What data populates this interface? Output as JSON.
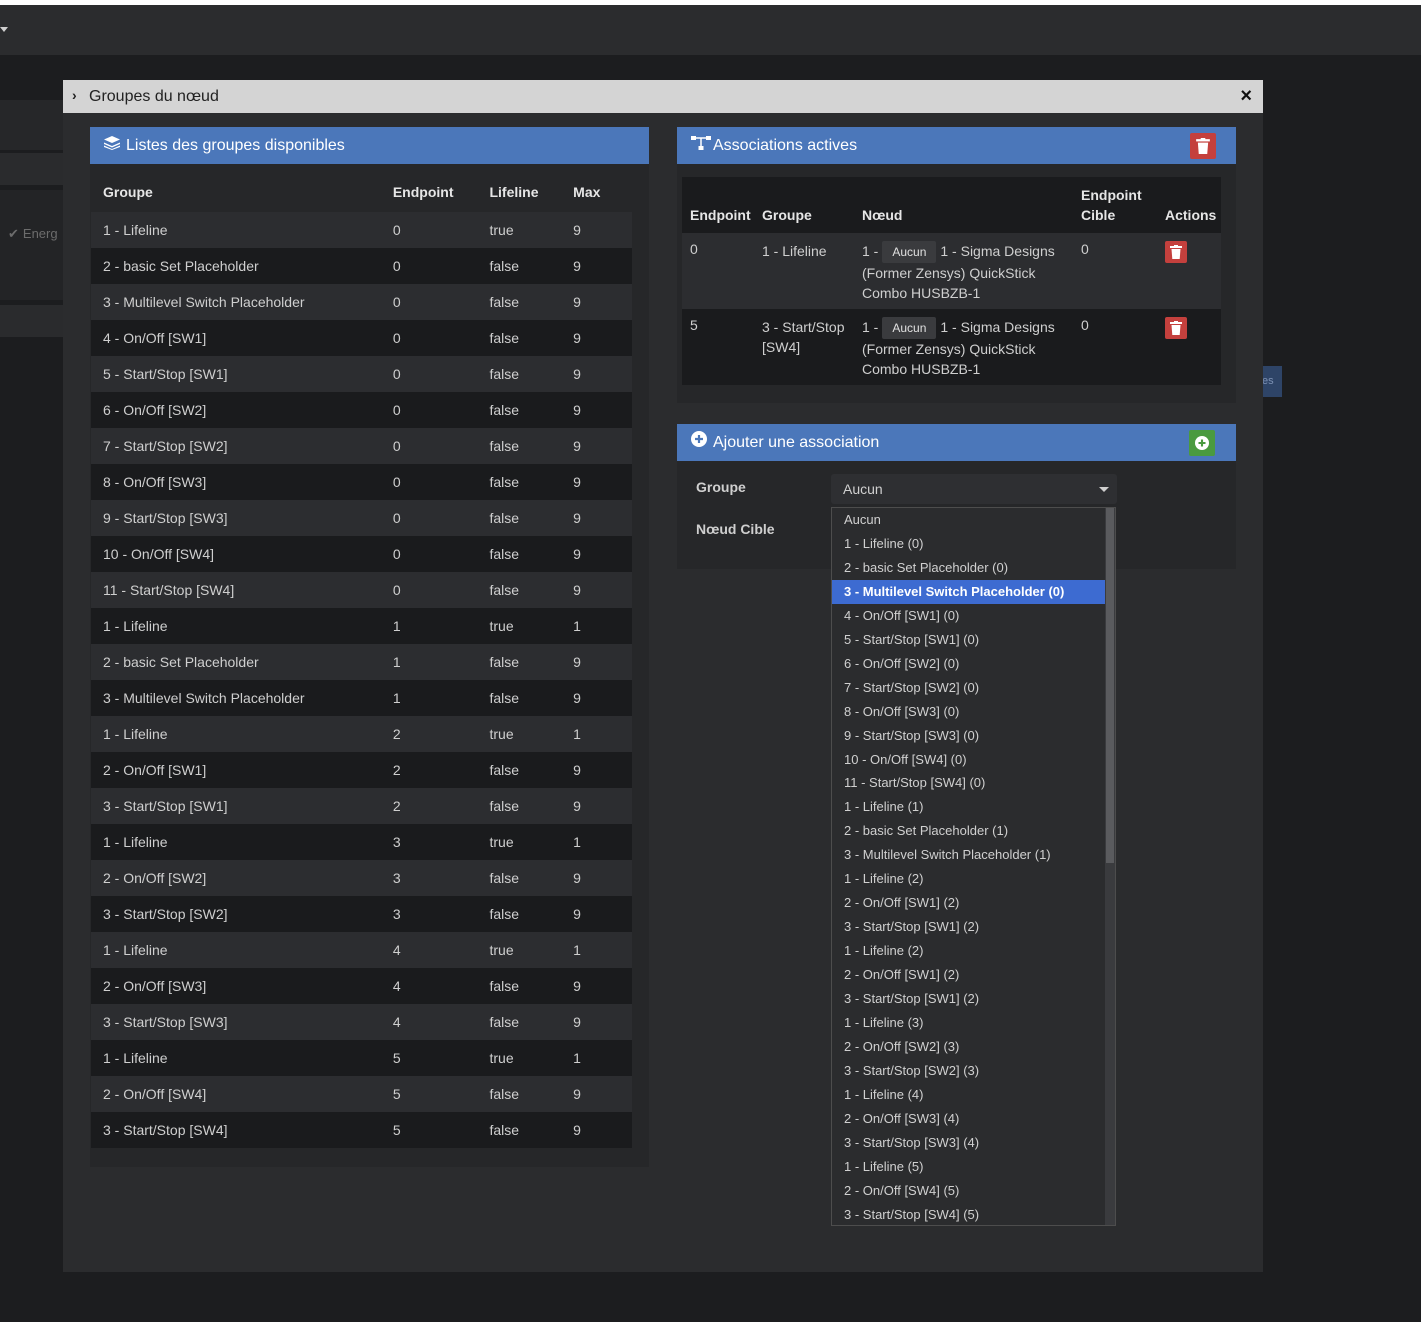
{
  "background": {
    "energy_label": "Energ",
    "button_label": "es"
  },
  "modal": {
    "title": "Groupes du nœud",
    "close_glyph": "×"
  },
  "available_groups": {
    "title": "Listes des groupes disponibles",
    "headers": [
      "Groupe",
      "Endpoint",
      "Lifeline",
      "Max"
    ],
    "rows": [
      [
        "1 - Lifeline",
        "0",
        "true",
        "9"
      ],
      [
        "2 - basic Set Placeholder",
        "0",
        "false",
        "9"
      ],
      [
        "3 - Multilevel Switch Placeholder",
        "0",
        "false",
        "9"
      ],
      [
        "4 - On/Off [SW1]",
        "0",
        "false",
        "9"
      ],
      [
        "5 - Start/Stop [SW1]",
        "0",
        "false",
        "9"
      ],
      [
        "6 - On/Off [SW2]",
        "0",
        "false",
        "9"
      ],
      [
        "7 - Start/Stop [SW2]",
        "0",
        "false",
        "9"
      ],
      [
        "8 - On/Off [SW3]",
        "0",
        "false",
        "9"
      ],
      [
        "9 - Start/Stop [SW3]",
        "0",
        "false",
        "9"
      ],
      [
        "10 - On/Off [SW4]",
        "0",
        "false",
        "9"
      ],
      [
        "11 - Start/Stop [SW4]",
        "0",
        "false",
        "9"
      ],
      [
        "1 - Lifeline",
        "1",
        "true",
        "1"
      ],
      [
        "2 - basic Set Placeholder",
        "1",
        "false",
        "9"
      ],
      [
        "3 - Multilevel Switch Placeholder",
        "1",
        "false",
        "9"
      ],
      [
        "1 - Lifeline",
        "2",
        "true",
        "1"
      ],
      [
        "2 - On/Off [SW1]",
        "2",
        "false",
        "9"
      ],
      [
        "3 - Start/Stop [SW1]",
        "2",
        "false",
        "9"
      ],
      [
        "1 - Lifeline",
        "3",
        "true",
        "1"
      ],
      [
        "2 - On/Off [SW2]",
        "3",
        "false",
        "9"
      ],
      [
        "3 - Start/Stop [SW2]",
        "3",
        "false",
        "9"
      ],
      [
        "1 - Lifeline",
        "4",
        "true",
        "1"
      ],
      [
        "2 - On/Off [SW3]",
        "4",
        "false",
        "9"
      ],
      [
        "3 - Start/Stop [SW3]",
        "4",
        "false",
        "9"
      ],
      [
        "1 - Lifeline",
        "5",
        "true",
        "1"
      ],
      [
        "2 - On/Off [SW4]",
        "5",
        "false",
        "9"
      ],
      [
        "3 - Start/Stop [SW4]",
        "5",
        "false",
        "9"
      ]
    ]
  },
  "active_associations": {
    "title": "Associations actives",
    "headers": {
      "endpoint": "Endpoint",
      "groupe": "Groupe",
      "noeud": "Nœud",
      "endpoint_cible_1": "Endpoint",
      "endpoint_cible_2": "Cible",
      "actions": "Actions"
    },
    "rows": [
      {
        "endpoint": "0",
        "groupe": "1 - Lifeline",
        "groupe_2": "",
        "node_prefix": "1 -",
        "tag": "Aucun",
        "node_l1": "1 - Sigma Designs",
        "node_l2": "(Former Zensys) QuickStick",
        "node_l3": "Combo HUSBZB-1",
        "endpoint_cible": "0"
      },
      {
        "endpoint": "5",
        "groupe": "3 - Start/Stop",
        "groupe_2": "[SW4]",
        "node_prefix": "1 -",
        "tag": "Aucun",
        "node_l1": "1 - Sigma Designs",
        "node_l2": "(Former Zensys) QuickStick",
        "node_l3": "Combo HUSBZB-1",
        "endpoint_cible": "0"
      }
    ]
  },
  "add_association": {
    "title": "Ajouter une association",
    "group_label": "Groupe",
    "target_label": "Nœud Cible",
    "selected_value": "Aucun",
    "dropdown_options": [
      "Aucun",
      "1 - Lifeline (0)",
      "2 - basic Set Placeholder (0)",
      "3 - Multilevel Switch Placeholder (0)",
      "4 - On/Off [SW1] (0)",
      "5 - Start/Stop [SW1] (0)",
      "6 - On/Off [SW2] (0)",
      "7 - Start/Stop [SW2] (0)",
      "8 - On/Off [SW3] (0)",
      "9 - Start/Stop [SW3] (0)",
      "10 - On/Off [SW4] (0)",
      "11 - Start/Stop [SW4] (0)",
      "1 - Lifeline (1)",
      "2 - basic Set Placeholder (1)",
      "3 - Multilevel Switch Placeholder (1)",
      "1 - Lifeline (2)",
      "2 - On/Off [SW1] (2)",
      "3 - Start/Stop [SW1] (2)",
      "1 - Lifeline (2)",
      "2 - On/Off [SW1] (2)",
      "3 - Start/Stop [SW1] (2)",
      "1 - Lifeline (3)",
      "2 - On/Off [SW2] (3)",
      "3 - Start/Stop [SW2] (3)",
      "1 - Lifeline (4)",
      "2 - On/Off [SW3] (4)",
      "3 - Start/Stop [SW3] (4)",
      "1 - Lifeline (5)",
      "2 - On/Off [SW4] (5)",
      "3 - Start/Stop [SW4] (5)"
    ],
    "highlighted_index": 3
  },
  "colors": {
    "panel_header": "#4b77ba",
    "delete_red": "#c4403d",
    "add_green": "#4a9a3f",
    "highlight_blue": "#3d6bd1"
  },
  "icons": {
    "available_groups": "layers-icon",
    "active_associations": "sitemap-icon",
    "add_association": "plus-circle-icon",
    "delete": "trash-icon",
    "add": "plus-circle-icon",
    "modal_toggle": "chevron-right-icon",
    "close": "close-icon"
  }
}
